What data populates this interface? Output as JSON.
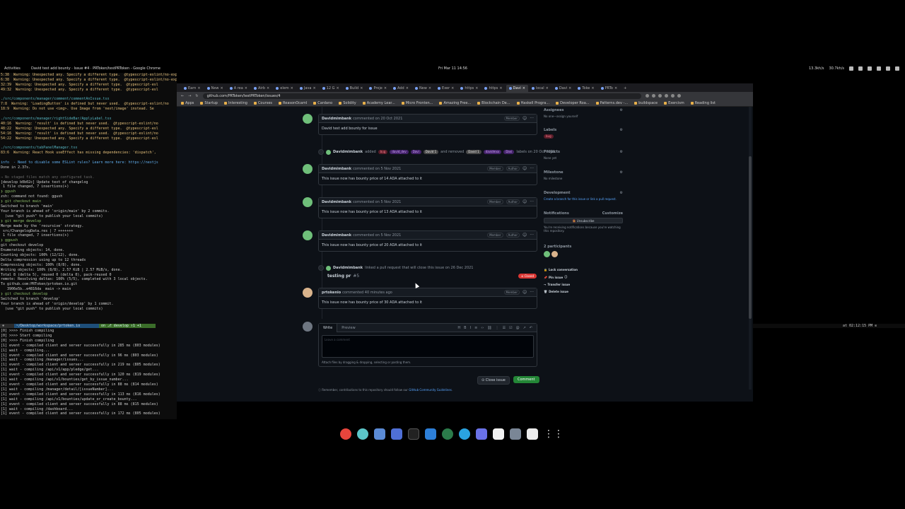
{
  "topbar": {
    "activities": "Activities",
    "window_title": "David test add bounty · Issue #4 · PRToken/testPRToken - Google Chrome",
    "clock": "Fri Mar 11  14:56",
    "net_down": "13.3kh/s",
    "net_up": "30.7kh/s"
  },
  "terminal": {
    "lines": [
      {
        "t": "5:38  Warning: Unexpected any. Specify a different type.  @typescript-eslint/no-explicit-any",
        "c": "c-y"
      },
      {
        "t": "6:38  Warning: Unexpected any. Specify a different type.  @typescript-eslint/no-explicit-any",
        "c": "c-y"
      },
      {
        "t": "32:39  Warning: Unexpected any. Specify a different type.  @typescript-esl",
        "c": "c-y"
      },
      {
        "t": "49:32  Warning: Unexpected any. Specify a different type.  @typescript-esl",
        "c": "c-y"
      },
      {
        "t": "",
        "c": ""
      },
      {
        "t": "./src/components/manager/comment/commentAnIssue.tsx",
        "c": "c-c"
      },
      {
        "t": "7:8  Warning: 'LoadingButton' is defined but never used.  @typescript-eslint/no",
        "c": "c-y"
      },
      {
        "t": "18:9  Warning: Do not use <img>. Use Image from 'next/image' instead. Se",
        "c": "c-y"
      },
      {
        "t": "",
        "c": ""
      },
      {
        "t": "./src/components/manager/rightSideBar/ApplyLabel.tsx",
        "c": "c-c"
      },
      {
        "t": "40:16  Warning: 'result' is defined but never used.  @typescript-eslint/no",
        "c": "c-y"
      },
      {
        "t": "48:22  Warning: Unexpected any. Specify a different type.  @typescript-esl",
        "c": "c-y"
      },
      {
        "t": "54:16  Warning: 'result' is defined but never used.  @typescript-eslint/no",
        "c": "c-y"
      },
      {
        "t": "54:22  Warning: Unexpected any. Specify a different type.  @typescript-esl",
        "c": "c-y"
      },
      {
        "t": "",
        "c": ""
      },
      {
        "t": "./src/components/tabPanelManager.tsx",
        "c": "c-c"
      },
      {
        "t": "83:6  Warning: React Hook useEffect has missing dependencies: 'dispatch',",
        "c": "c-y"
      },
      {
        "t": "",
        "c": ""
      },
      {
        "t": "info  - Need to disable some ESLint rules? Learn more here: https://nextjs",
        "c": "c-b"
      },
      {
        "t": "Done in 2.37s.",
        "c": ""
      },
      {
        "t": "",
        "c": ""
      },
      {
        "t": "→ No staged files match any configured task.",
        "c": "c-d"
      },
      {
        "t": "[develop b0b02c] Update text of changelog",
        "c": ""
      },
      {
        "t": " 1 file changed, 7 insertions(+)",
        "c": ""
      },
      {
        "t": "❯ ggush",
        "c": "c-g"
      },
      {
        "t": "zsh: command not found: ggush",
        "c": ""
      },
      {
        "t": "❯ git checkout main",
        "c": "c-g"
      },
      {
        "t": "Switched to branch 'main'",
        "c": ""
      },
      {
        "t": "Your branch is ahead of 'origin/main' by 2 commits.",
        "c": ""
      },
      {
        "t": "  (use \"git push\" to publish your local commits)",
        "c": ""
      },
      {
        "t": "❯ git merge develop",
        "c": "c-g"
      },
      {
        "t": "Merge made by the 'recursive' strategy.",
        "c": ""
      },
      {
        "t": " src/ChangelogData.res | 7 +++++++",
        "c": ""
      },
      {
        "t": " 1 file changed, 7 insertions(+)",
        "c": ""
      },
      {
        "t": "❯ ggpush",
        "c": "c-g"
      },
      {
        "t": "git checkout develop",
        "c": ""
      },
      {
        "t": "Enumerating objects: 14, done.",
        "c": ""
      },
      {
        "t": "Counting objects: 100% (12/12), done.",
        "c": ""
      },
      {
        "t": "Delta compression using up to 12 threads",
        "c": ""
      },
      {
        "t": "Compressing objects: 100% (8/8), done.",
        "c": ""
      },
      {
        "t": "Writing objects: 100% (8/8), 2.57 KiB | 2.57 MiB/s, done.",
        "c": ""
      },
      {
        "t": "Total 8 (delta 5), reused 0 (delta 0), pack-reused 0",
        "c": ""
      },
      {
        "t": "remote: Resolving deltas: 100% (5/5), completed with 3 local objects.",
        "c": ""
      },
      {
        "t": "To github.com:PRToken/prtoken.io.git",
        "c": ""
      },
      {
        "t": "   3906e5b..e4816da  main -> main",
        "c": ""
      },
      {
        "t": "❯ git checkout develop",
        "c": "c-g"
      },
      {
        "t": "Switched to branch 'develop'",
        "c": ""
      },
      {
        "t": "Your branch is ahead of 'origin/develop' by 1 commit.",
        "c": ""
      },
      {
        "t": "  (use \"git push\" to publish your local commits)",
        "c": ""
      }
    ],
    "prompt_path": "~/Desktop/workspace/prtoken.io",
    "prompt_branch": "on ⎇ develop ↑1 +1",
    "prompt_time": "at 02:12:15 PM ⊙",
    "log": [
      {
        "t": "[0] >>>> Finish compiling",
        "c": ""
      },
      {
        "t": "[0] >>>> Start compiling",
        "c": ""
      },
      {
        "t": "[0] >>>> Finish compiling",
        "c": ""
      },
      {
        "t": "[1] event - compiled client and server successfully in 285 ms (803 modules)",
        "c": ""
      },
      {
        "t": "[1] wait  - compiling...",
        "c": ""
      },
      {
        "t": "[1] event - compiled client and server successfully in 96 ms (803 modules)",
        "c": ""
      },
      {
        "t": "[1] wait  - compiling /manager/issues...",
        "c": ""
      },
      {
        "t": "[1] event - compiled client and server successfully in 219 ms (805 modules)",
        "c": ""
      },
      {
        "t": "[1] wait  - compiling /api/v1/app/pledge/get...",
        "c": ""
      },
      {
        "t": "[1] event - compiled client and server successfully in 120 ms (819 modules)",
        "c": ""
      },
      {
        "t": "[1] wait  - compiling /api/v1/bounties/get_by_issue_number...",
        "c": ""
      },
      {
        "t": "[1] event - compiled client and server successfully in 88 ms (814 modules)",
        "c": ""
      },
      {
        "t": "[1] wait  - compiling /manager/detail/[issueNumber]...",
        "c": ""
      },
      {
        "t": "[1] event - compiled client and server successfully in 113 ms (816 modules)",
        "c": ""
      },
      {
        "t": "[1] wait  - compiling /api/v1/bounties/update_or_create_bounty...",
        "c": ""
      },
      {
        "t": "[1] event - compiled client and server successfully in 88 ms (815 modules)",
        "c": ""
      },
      {
        "t": "[1] wait  - compiling /dashboard...",
        "c": ""
      },
      {
        "t": "[1] event - compiled client and server successfully in 172 ms (805 modules)",
        "c": ""
      }
    ]
  },
  "browser": {
    "tabs": [
      "Earn",
      "New",
      "A rea",
      "Airb",
      "elem",
      "Java",
      "12 G",
      "Build",
      "Proje",
      "Add ",
      "New",
      "Exer",
      "https",
      "https",
      "Davi",
      "local",
      "Davi",
      "Toke",
      "PRTo"
    ],
    "active_tab_index": 14,
    "url": "github.com/PRToken/testPRToken/issues/4",
    "bookmarks": [
      "Apps",
      "Startup",
      "Interesting",
      "Courses",
      "ReasonOcaml",
      "Cardano",
      "Solidity",
      "Academy Lear...",
      "Micro Fronten...",
      "Amazing Free...",
      "Blockchain De...",
      "Haskell Progra...",
      "Developer Roa...",
      "Patterns.dev -...",
      "buildspace",
      "Exercism",
      "Reading list"
    ]
  },
  "issue": {
    "comment0": {
      "author": "Davidmimbank",
      "meta": "commented on 20 Oct 2021",
      "role": "Member",
      "body": "David test add bounty for issue"
    },
    "label_event": {
      "author": "Davidmimbank",
      "added": "added",
      "labels_added": [
        "bug",
        "david_dev",
        "Davi",
        "David 1"
      ],
      "and_removed": "and removed",
      "labels_removed": [
        "David 1",
        "davidmxx",
        "Davi"
      ],
      "tail": "labels on 20 Oct 2021"
    },
    "comment1": {
      "author": "Davidmimbank",
      "meta": "commented on 5 Nov 2021",
      "role": "Member",
      "role2": "Author",
      "body": "This issue now has bounty price of 14 ADA attached to it"
    },
    "comment2": {
      "author": "Davidmimbank",
      "meta": "commented on 5 Nov 2021",
      "role": "Member",
      "role2": "Author",
      "body": "This issue now has bounty price of 13 ADA attached to it"
    },
    "comment3": {
      "author": "Davidmimbank",
      "meta": "commented on 5 Nov 2021",
      "role": "Member",
      "role2": "Author",
      "body": "This issue now has bounty price of 20 ADA attached to it"
    },
    "link_event": {
      "author": "Davidmimbank",
      "text": "linked a pull request that will close this issue on 26 Dec 2021",
      "pr_title": "testing pr",
      "pr_number": "#5",
      "status": "Closed"
    },
    "comment4": {
      "author": "prtokenio",
      "meta": "commented 40 minutes ago",
      "role": "Member",
      "body": "This issue now has bounty price of 30 ADA attached to it"
    },
    "composer": {
      "tab_write": "Write",
      "tab_preview": "Preview",
      "placeholder": "Leave a comment",
      "attach": "Attach files by dragging & dropping, selecting or pasting them."
    },
    "close_btn": "Close issue",
    "comment_btn": "Comment",
    "remember_pre": "Remember, contributions to this repository should follow our",
    "remember_link": "GitHub Community Guidelines",
    "remember_post": "."
  },
  "sidebar": {
    "assignees": {
      "title": "Assignees",
      "value": "No one—assign yourself"
    },
    "labels": {
      "title": "Labels",
      "value": "bug"
    },
    "projects": {
      "title": "Projects",
      "value": "None yet"
    },
    "milestone": {
      "title": "Milestone",
      "value": "No milestone"
    },
    "development": {
      "title": "Development",
      "value": "Create a branch for this issue or link a pull request."
    },
    "notifications": {
      "title": "Notifications",
      "customize": "Customize",
      "button": "Unsubscribe",
      "note": "You're receiving notifications because you're watching this repository."
    },
    "participants": {
      "title": "2 participants"
    },
    "actions": [
      "Lock conversation",
      "Pin issue",
      "Transfer issue",
      "Delete issue"
    ]
  },
  "colors": {
    "accent": "#58a6ff",
    "green": "#238636",
    "closed": "#da3633",
    "bg": "#0d1117"
  }
}
